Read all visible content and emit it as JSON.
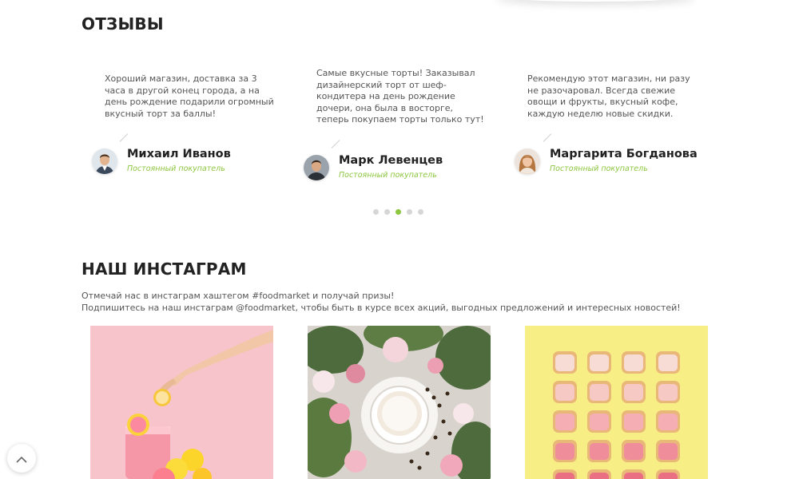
{
  "reviews": {
    "title": "ОТЗЫВЫ",
    "items": [
      {
        "text": "Хороший магазин, доставка за 3 часа в другой конец города, а на день рождение подарили огромный вкусный торт за баллы!",
        "name": "Михаил Иванов",
        "role": "Постоянный покупатель"
      },
      {
        "text": "Самые вкусные торты! Заказывал дизайнерский торт от шеф-кондитера на день рождение дочери, она была в восторге, теперь покупаем торты только тут!",
        "name": "Марк Левенцев",
        "role": "Постоянный покупатель"
      },
      {
        "text": "Рекомендую этот магазин, ни разу не разочаровал. Всегда свежие овощи и фрукты, вкусный кофе, каждую неделю новые скидки.",
        "name": "Маргарита Богданова",
        "role": "Постоянный покупатель"
      }
    ],
    "pagination": {
      "count": 5,
      "active_index": 2
    }
  },
  "instagram": {
    "title": "НАШ ИНСТАГРАМ",
    "line1": "Отмечай нас в инстаграм хаштегом #foodmarket и получай призы!",
    "line2": "Подпишитесь на наш инстаграм @foodmarket, чтобы быть в курсе всех акций, выгодных предложений и интересных новостей!"
  },
  "colors": {
    "accent": "#8dc63f",
    "dot_inactive": "#d6d6d6",
    "photo1_bg": "#f7c4cc",
    "photo2_bg": "#d8d4cd",
    "photo3_bg": "#f7ef86"
  },
  "icons": {
    "scroll_top": "chevron-up-icon"
  }
}
